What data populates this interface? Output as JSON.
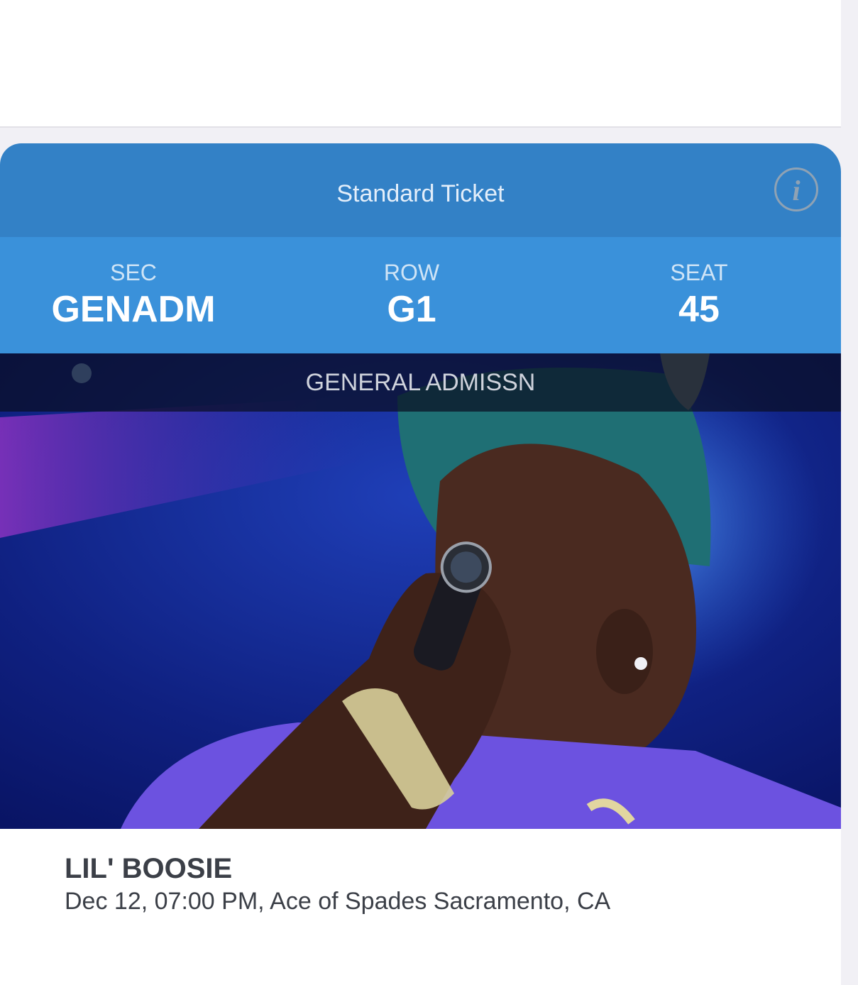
{
  "ticket": {
    "type": "Standard Ticket",
    "info_icon": "info-icon",
    "section": {
      "label": "SEC",
      "value": "GENADM"
    },
    "row": {
      "label": "ROW",
      "value": "G1"
    },
    "seat": {
      "label": "SEAT",
      "value": "45"
    },
    "admission": "GENERAL ADMISSN"
  },
  "event": {
    "title": "LIL' BOOSIE",
    "details": "Dec 12, 07:00 PM, Ace of Spades Sacramento, CA"
  },
  "colors": {
    "header": "#3381c6",
    "seat_bar": "#3a91da",
    "text_dark": "#3b3f47"
  }
}
